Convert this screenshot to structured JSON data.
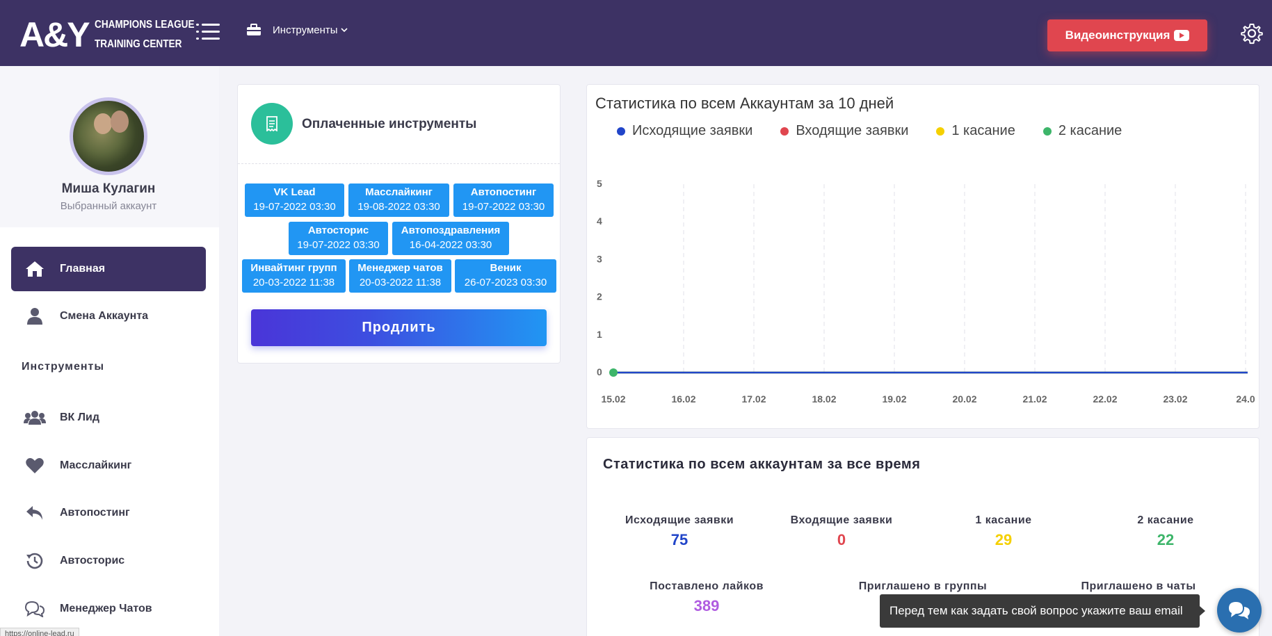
{
  "header": {
    "logo_mark": "A&Y",
    "logo_line1": "CHAMPIONS LEAGUE",
    "logo_line2": "TRAINING CENTER",
    "tools_menu_label": "Инструменты",
    "video_button_label": "Видеоинструкция",
    "colors": {
      "background": "#3d3264",
      "video_button": "#e0464f"
    }
  },
  "sidebar": {
    "profile": {
      "name": "Миша Кулагин",
      "subtitle": "Выбранный аккаунт"
    },
    "nav": [
      {
        "label": "Главная",
        "icon": "home-icon",
        "active": true
      },
      {
        "label": "Смена Аккаунта",
        "icon": "user-icon",
        "active": false
      }
    ],
    "section_label": "Инструменты",
    "tools": [
      {
        "label": "ВК Лид",
        "icon": "users-icon"
      },
      {
        "label": "Масслайкинг",
        "icon": "heart-icon"
      },
      {
        "label": "Автопостинг",
        "icon": "reply-icon"
      },
      {
        "label": "Автосторис",
        "icon": "history-icon"
      },
      {
        "label": "Менеджер Чатов",
        "icon": "chats-icon"
      }
    ],
    "status_url": "https://online-lead.ru"
  },
  "paid_tools": {
    "title": "Оплаченные инструменты",
    "tags": [
      {
        "name": "VK Lead",
        "date": "19-07-2022 03:30"
      },
      {
        "name": "Масслайкинг",
        "date": "19-08-2022 03:30"
      },
      {
        "name": "Автопостинг",
        "date": "19-07-2022 03:30"
      },
      {
        "name": "Автосторис",
        "date": "19-07-2022 03:30"
      },
      {
        "name": "Автопоздравления",
        "date": "16-04-2022 03:30"
      },
      {
        "name": "Инвайтинг групп",
        "date": "20-03-2022 11:38"
      },
      {
        "name": "Менеджер чатов",
        "date": "20-03-2022 11:38"
      },
      {
        "name": "Веник",
        "date": "26-07-2023 03:30"
      }
    ],
    "extend_button_label": "Продлить",
    "tag_color": "#2196f3"
  },
  "chart_card": {
    "title": "Статистика по всем Аккаунтам за 10 дней"
  },
  "chart_data": {
    "type": "line",
    "title": "Статистика по всем Аккаунтам за 10 дней",
    "categories": [
      "15.02",
      "16.02",
      "17.02",
      "18.02",
      "19.02",
      "20.02",
      "21.02",
      "22.02",
      "23.02",
      "24.0"
    ],
    "ylim": [
      0,
      5
    ],
    "y_ticks": [
      "0",
      "1",
      "2",
      "3",
      "4",
      "5"
    ],
    "series": [
      {
        "name": "Исходящие заявки",
        "color": "#2145c9",
        "values": [
          0,
          0,
          0,
          0,
          0,
          0,
          0,
          0,
          0,
          0
        ]
      },
      {
        "name": "Входящие заявки",
        "color": "#e0464f",
        "values": [
          0,
          0,
          0,
          0,
          0,
          0,
          0,
          0,
          0,
          0
        ]
      },
      {
        "name": "1 касание",
        "color": "#f5d000",
        "values": [
          0,
          0,
          0,
          0,
          0,
          0,
          0,
          0,
          0,
          0
        ]
      },
      {
        "name": "2 касание",
        "color": "#3db56a",
        "values": [
          0,
          0,
          0,
          0,
          0,
          0,
          0,
          0,
          0,
          0
        ]
      }
    ],
    "grid": "vertical-dashed",
    "legend_position": "top-left"
  },
  "stats": {
    "title": "Статистика по всем аккаунтам за все время",
    "items": [
      {
        "label": "Исходящие заявки",
        "value": "75",
        "color": "#2145c9"
      },
      {
        "label": "Входящие заявки",
        "value": "0",
        "color": "#e0464f"
      },
      {
        "label": "1 касание",
        "value": "29",
        "color": "#f5d000"
      },
      {
        "label": "2 касание",
        "value": "22",
        "color": "#3db56a"
      },
      {
        "label": "Поставлено лайков",
        "value": "389",
        "color": "#b05ce0"
      },
      {
        "label": "Приглашено в группы",
        "value": "",
        "color": "#2145c9"
      },
      {
        "label": "Приглашено в чаты",
        "value": "",
        "color": "#2145c9"
      }
    ]
  },
  "chat_widget": {
    "tooltip": "Перед тем как задать свой вопрос укажите ваш email"
  }
}
